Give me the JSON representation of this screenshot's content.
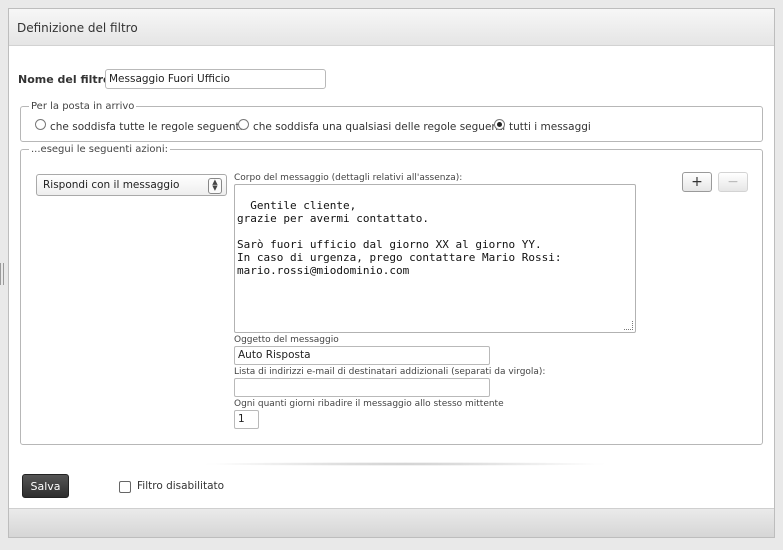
{
  "dialog": {
    "title": "Definizione del filtro"
  },
  "filter": {
    "name_label": "Nome del filtro:",
    "name_value": "Messaggio Fuori Ufficio"
  },
  "incoming": {
    "legend": "Per la posta in arrivo",
    "options": [
      {
        "label": "che soddisfa tutte le regole seguenti",
        "checked": false
      },
      {
        "label": "che soddisfa una qualsiasi delle regole seguenti",
        "checked": false
      },
      {
        "label": "tutti i messaggi",
        "checked": true
      }
    ]
  },
  "actions": {
    "legend": "...esegui le seguenti azioni:",
    "action_select": "Rispondi con il messaggio",
    "body_label": "Corpo del messaggio (dettagli relativi all'assenza):",
    "body_text": "Gentile cliente,\ngrazie per avermi contattato.\n\nSarò fuori ufficio dal giorno XX al giorno YY.\nIn caso di urgenza, prego contattare Mario Rossi:\nmario.rossi@miodominio.com",
    "subject_label": "Oggetto del messaggio",
    "subject_value": "Auto Risposta",
    "addresses_label": "Lista di indirizzi e-mail di destinatari addizionali (separati da virgola):",
    "addresses_value": "",
    "days_label": "Ogni quanti giorni ribadire il messaggio allo stesso mittente",
    "days_value": "1",
    "add_label": "+",
    "remove_label": "−"
  },
  "footer": {
    "save_label": "Salva",
    "disabled_label": "Filtro disabilitato",
    "disabled_checked": false
  }
}
